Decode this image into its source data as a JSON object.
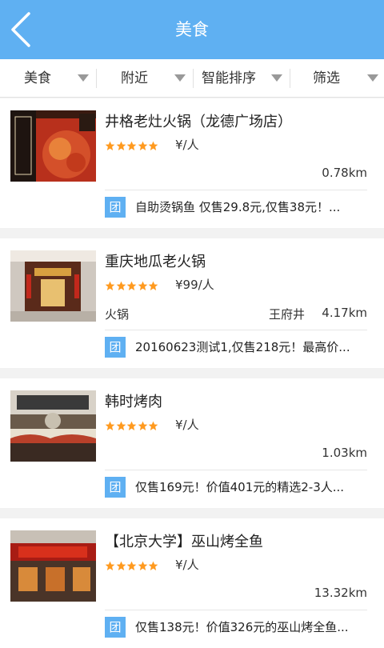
{
  "header": {
    "title": "美食",
    "back_icon": "back-arrow-icon"
  },
  "filters": [
    {
      "label": "美食"
    },
    {
      "label": "附近"
    },
    {
      "label": "智能排序"
    },
    {
      "label": "筛选"
    }
  ],
  "colors": {
    "brand": "#5fb0f2",
    "star": "#ff9a1f"
  },
  "restaurants": [
    {
      "name": "井格老灶火锅（龙德广场店）",
      "rating": 5,
      "price": "¥/人",
      "category": "",
      "area": "",
      "distance": "0.78km",
      "deal_badge": "团",
      "deal": "自助烫锅鱼 仅售29.8元,仅售38元！..."
    },
    {
      "name": "重庆地瓜老火锅",
      "rating": 5,
      "price": "¥99/人",
      "category": "火锅",
      "area": "王府井",
      "distance": "4.17km",
      "deal_badge": "团",
      "deal": "20160623测试1,仅售218元！最高价..."
    },
    {
      "name": "韩时烤肉",
      "rating": 5,
      "price": "¥/人",
      "category": "",
      "area": "",
      "distance": "1.03km",
      "deal_badge": "团",
      "deal": "仅售169元！价值401元的精选2-3人..."
    },
    {
      "name": "【北京大学】巫山烤全鱼",
      "rating": 5,
      "price": "¥/人",
      "category": "",
      "area": "",
      "distance": "13.32km",
      "deal_badge": "团",
      "deal": "仅售138元！价值326元的巫山烤全鱼..."
    }
  ]
}
